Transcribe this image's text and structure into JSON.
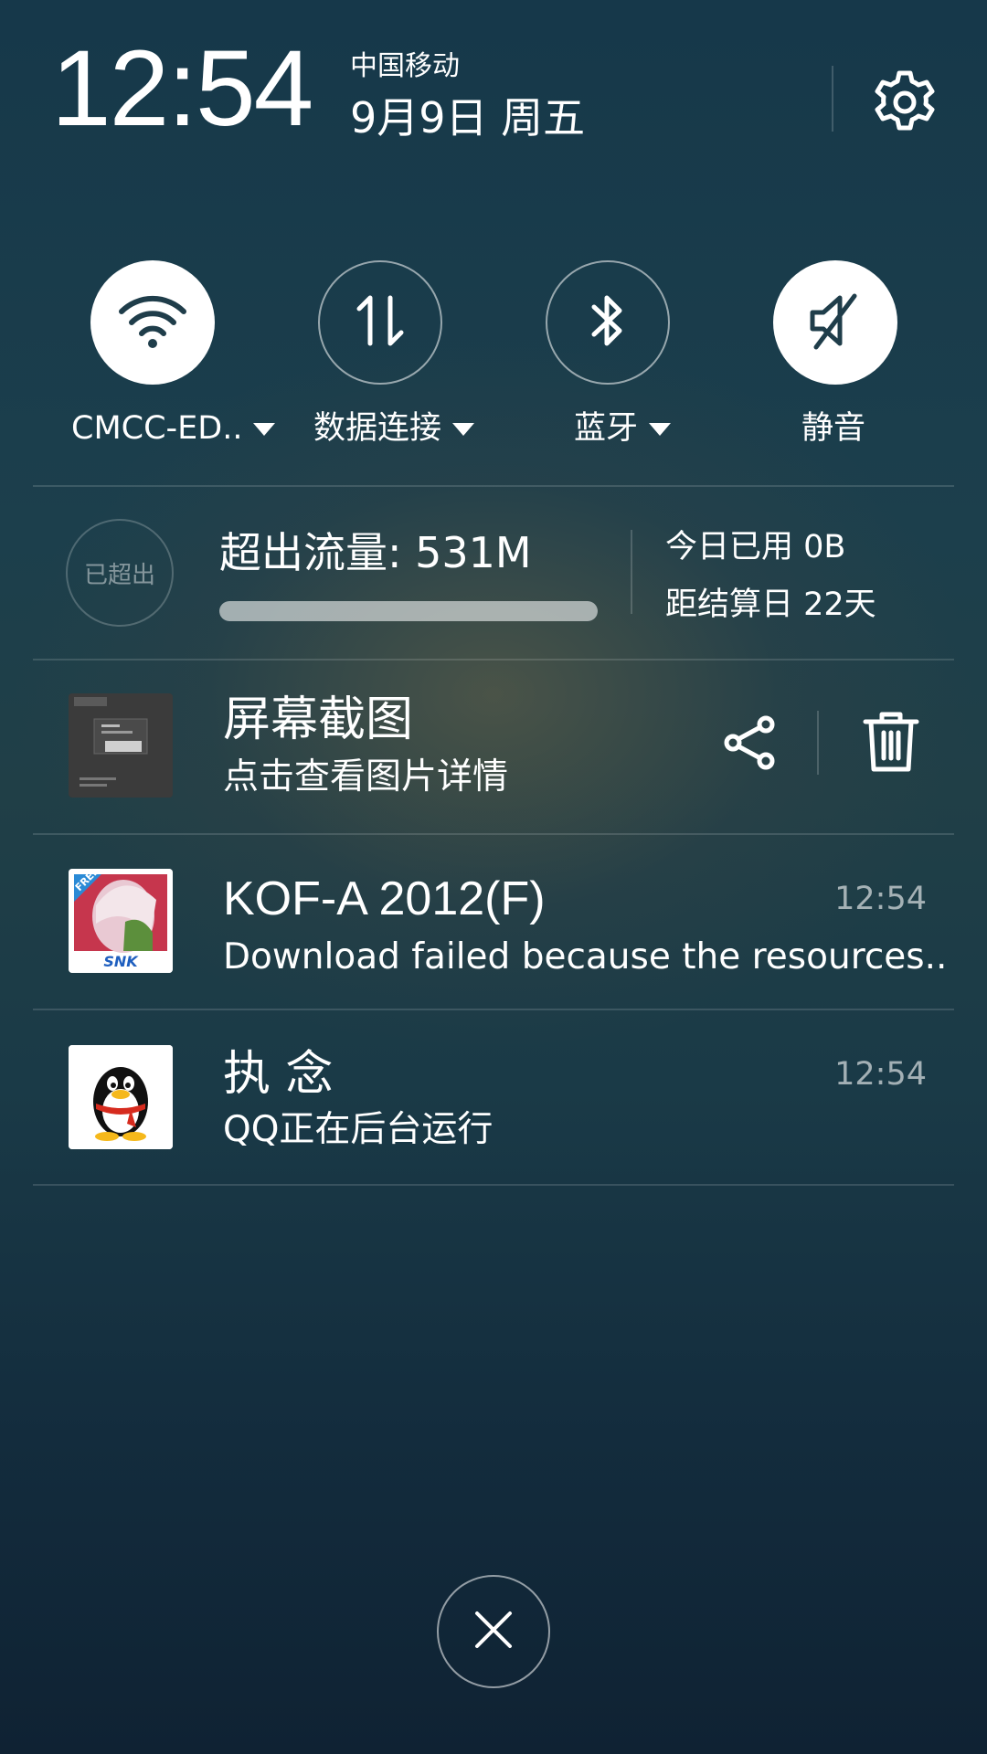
{
  "header": {
    "time": "12:54",
    "carrier": "中国移动",
    "date": "9月9日 周五",
    "settings_icon": "gear-icon"
  },
  "toggles": [
    {
      "label": "CMCC-ED..",
      "icon": "wifi-icon",
      "state": "on",
      "has_dropdown": true
    },
    {
      "label": "数据连接",
      "icon": "data-arrows-icon",
      "state": "off",
      "has_dropdown": true
    },
    {
      "label": "蓝牙",
      "icon": "bluetooth-icon",
      "state": "off",
      "has_dropdown": true
    },
    {
      "label": "静音",
      "icon": "mute-icon",
      "state": "on",
      "has_dropdown": false
    }
  ],
  "data_usage": {
    "badge": "已超出",
    "title": "超出流量: 531M",
    "progress": 1.0,
    "today_used": "今日已用 0B",
    "days_to_settlement": "距结算日 22天"
  },
  "notifications": [
    {
      "title": "屏幕截图",
      "subtitle": "点击查看图片详情",
      "time": "",
      "icon": "screenshot-thumbnail",
      "actions": [
        "share-icon",
        "trash-icon"
      ]
    },
    {
      "title": "KOF-A 2012(F)",
      "subtitle": "Download failed because the resources..",
      "time": "12:54",
      "icon": "kof-app-icon",
      "badge_text": "FREE",
      "brand_text": "SNK"
    },
    {
      "title": "执 念",
      "subtitle": "QQ正在后台运行",
      "time": "12:54",
      "icon": "qq-penguin-icon"
    }
  ],
  "colors": {
    "background_top": "#16384a",
    "background_bottom": "#0f2233",
    "accent": "#ffffff"
  },
  "close_icon": "close-icon"
}
